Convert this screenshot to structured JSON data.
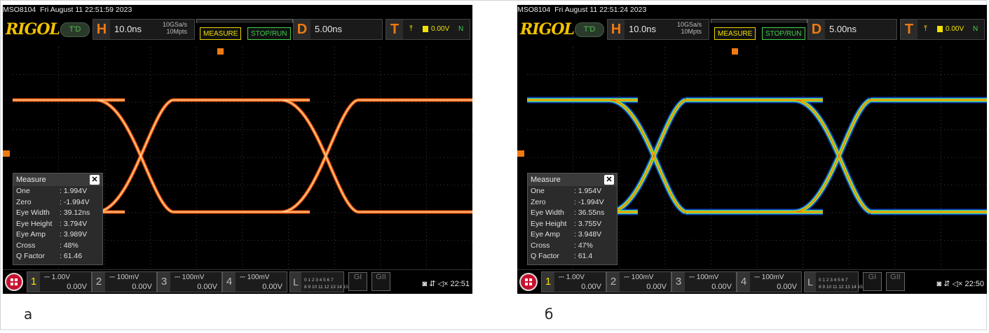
{
  "panels": [
    {
      "id": "a",
      "caption": "а",
      "header": {
        "model": "MSO8104",
        "datetime": "Fri August 11 22:51:59 2023"
      },
      "brand": "RIGOL",
      "run_state": "T'D",
      "horizontal": {
        "letter": "H",
        "value": "10.0ns",
        "sample_rate": "10GSa/s",
        "memory": "10Mpts"
      },
      "buttons": {
        "measure": "MEASURE",
        "stop_run": "STOP/RUN"
      },
      "delay": {
        "letter": "D",
        "value": "5.00ns"
      },
      "trigger": {
        "letter": "T",
        "level": "0.00V",
        "mode": "N"
      },
      "measure": {
        "title": "Measure",
        "rows": [
          {
            "label": "One",
            "value": ": 1.994V"
          },
          {
            "label": "Zero",
            "value": ": -1.994V"
          },
          {
            "label": "Eye Width",
            "value": ": 39.12ns"
          },
          {
            "label": "Eye Height",
            "value": ": 3.794V"
          },
          {
            "label": "Eye Amp",
            "value": ": 3.989V"
          },
          {
            "label": "Cross",
            "value": ": 48%"
          },
          {
            "label": "Q Factor",
            "value": ": 61.46"
          }
        ]
      },
      "channels": [
        {
          "num": "1",
          "scale": "1.00V",
          "offset": "0.00V"
        },
        {
          "num": "2",
          "scale": "100mV",
          "offset": "0.00V"
        },
        {
          "num": "3",
          "scale": "100mV",
          "offset": "0.00V"
        },
        {
          "num": "4",
          "scale": "100mV",
          "offset": "0.00V"
        }
      ],
      "logic": {
        "letter": "L",
        "row1": "0 1 2 3  4 5 6 7",
        "row2": "8 9 10 11  12 13 14 15"
      },
      "gi": "GI",
      "gii": "GII",
      "time": "22:51",
      "display_style": "orange"
    },
    {
      "id": "b",
      "caption": "б",
      "header": {
        "model": "MSO8104",
        "datetime": "Fri August 11 22:51:24 2023"
      },
      "brand": "RIGOL",
      "run_state": "T'D",
      "horizontal": {
        "letter": "H",
        "value": "10.0ns",
        "sample_rate": "10GSa/s",
        "memory": "10Mpts"
      },
      "buttons": {
        "measure": "MEASURE",
        "stop_run": "STOP/RUN"
      },
      "delay": {
        "letter": "D",
        "value": "5.00ns"
      },
      "trigger": {
        "letter": "T",
        "level": "0.00V",
        "mode": "N"
      },
      "measure": {
        "title": "Measure",
        "rows": [
          {
            "label": "One",
            "value": ": 1.954V"
          },
          {
            "label": "Zero",
            "value": ": -1.994V"
          },
          {
            "label": "Eye Width",
            "value": ": 36.55ns"
          },
          {
            "label": "Eye Height",
            "value": ": 3.755V"
          },
          {
            "label": "Eye Amp",
            "value": ": 3.948V"
          },
          {
            "label": "Cross",
            "value": ": 47%"
          },
          {
            "label": "Q Factor",
            "value": ": 61.4"
          }
        ]
      },
      "channels": [
        {
          "num": "1",
          "scale": "1.00V",
          "offset": "0.00V"
        },
        {
          "num": "2",
          "scale": "100mV",
          "offset": "0.00V"
        },
        {
          "num": "3",
          "scale": "100mV",
          "offset": "0.00V"
        },
        {
          "num": "4",
          "scale": "100mV",
          "offset": "0.00V"
        }
      ],
      "logic": {
        "letter": "L",
        "row1": "0 1 2 3  4 5 6 7",
        "row2": "8 9 10 11  12 13 14 15"
      },
      "gi": "GI",
      "gii": "GII",
      "time": "22:50",
      "display_style": "colorgrade"
    }
  ],
  "colors": {
    "accent_orange": "#f07a10",
    "measure_yellow": "#f2e200",
    "run_green": "#3fd24f",
    "logo_gold": "#f2c200"
  }
}
